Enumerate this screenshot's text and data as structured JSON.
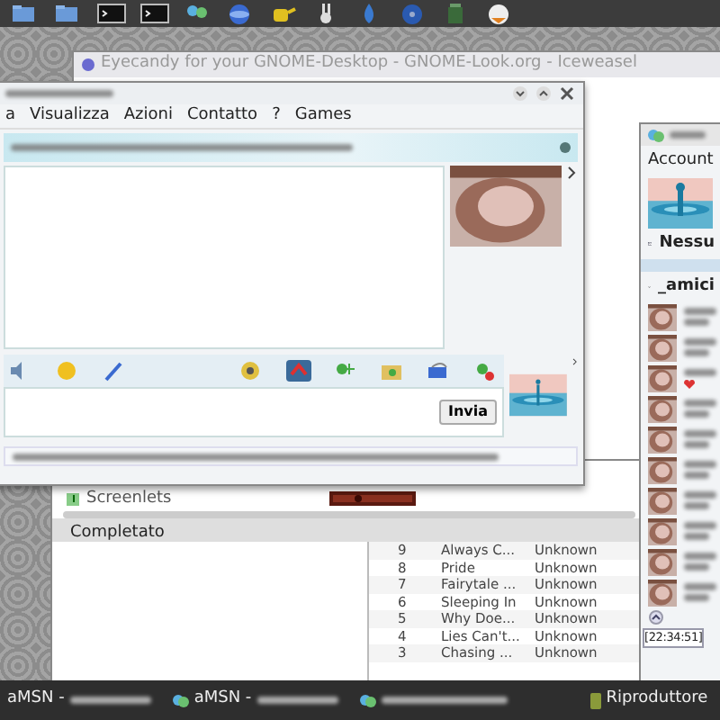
{
  "browser_window": {
    "title": "Eyecandy for your GNOME-Desktop - GNOME-Look.org - Iceweasel"
  },
  "player_window": {
    "sidebar_items": [
      "Screenlets"
    ],
    "status": "Completato",
    "tracks": [
      {
        "number": "9",
        "title": "Always C...",
        "artist": "Unknown"
      },
      {
        "number": "8",
        "title": "Pride",
        "artist": "Unknown"
      },
      {
        "number": "7",
        "title": "Fairytale ...",
        "artist": "Unknown"
      },
      {
        "number": "6",
        "title": "Sleeping In",
        "artist": "Unknown"
      },
      {
        "number": "5",
        "title": "Why Doe...",
        "artist": "Unknown"
      },
      {
        "number": "4",
        "title": "Lies Can't...",
        "artist": "Unknown"
      },
      {
        "number": "3",
        "title": "Chasing ...",
        "artist": "Unknown"
      }
    ]
  },
  "chat_window": {
    "menu": [
      "a",
      "Visualizza",
      "Azioni",
      "Contatto",
      "?",
      "Games"
    ],
    "send_button": "Invia"
  },
  "contacts_window": {
    "menu": [
      "Account"
    ],
    "status": "Nessu",
    "group": "_amici",
    "contacts": [
      {
        "kind": "plain"
      },
      {
        "kind": "plain"
      },
      {
        "kind": "heart"
      },
      {
        "kind": "plain"
      },
      {
        "kind": "plain"
      },
      {
        "kind": "plain"
      },
      {
        "kind": "plain"
      },
      {
        "kind": "plain"
      },
      {
        "kind": "plain"
      },
      {
        "kind": "plain"
      }
    ],
    "timestamp": "[22:34:51]"
  },
  "taskbar": [
    {
      "label": "aMSN -",
      "kind": "text"
    },
    {
      "label": "aMSN -",
      "kind": "icon"
    },
    {
      "kind": "blank"
    },
    {
      "label": "Riproduttore",
      "kind": "player"
    }
  ]
}
